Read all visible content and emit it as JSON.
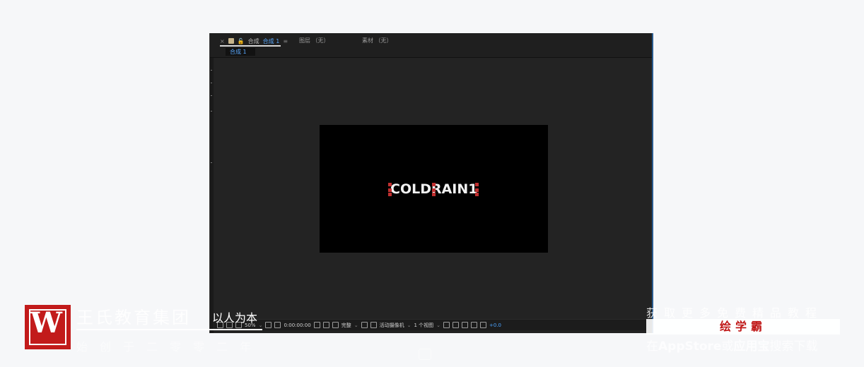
{
  "panel": {
    "tab_close": "×",
    "tab_prefix": "合成",
    "tab_comp": "合成 1",
    "tab_menu": "≡",
    "layer_label": "图层 （无）",
    "footage_label": "素材 （无）",
    "breadcrumb": "合成 1"
  },
  "viewer": {
    "text": "COLDRAIN1"
  },
  "bottombar": {
    "zoom": "50%",
    "timecode": "0:00:00:00",
    "resolution": "完整",
    "camera": "活动摄像机",
    "views": "1 个视图",
    "exposure": "+0.0"
  },
  "watermark": {
    "brand": "王氏教育集团",
    "slogan": "以人为本",
    "founded": "始创于二零零二年",
    "promo": "获取更多免费精品教程",
    "app_name": "绘学霸",
    "download_prefix": "在",
    "download_store": "AppStore",
    "download_mid": "或",
    "download_app": "应用宝",
    "download_suffix": "搜索下载"
  }
}
